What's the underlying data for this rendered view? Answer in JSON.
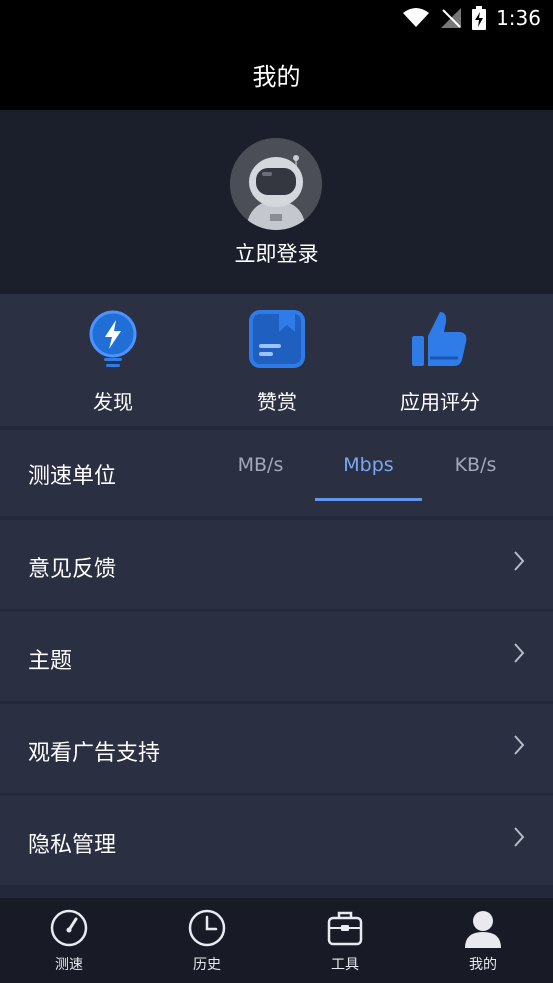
{
  "status_bar": {
    "time": "1:36",
    "icons": [
      "wifi-icon",
      "no-signal-icon",
      "battery-charging-icon"
    ]
  },
  "header": {
    "title": "我的"
  },
  "profile": {
    "login_label": "立即登录",
    "avatar_icon": "astronaut-avatar-icon"
  },
  "quick_actions": [
    {
      "label": "发现",
      "icon": "lightbulb-bolt-icon"
    },
    {
      "label": "赞赏",
      "icon": "book-bookmark-icon"
    },
    {
      "label": "应用评分",
      "icon": "thumbs-up-icon"
    }
  ],
  "speed_unit": {
    "label": "测速单位",
    "options": [
      "MB/s",
      "Mbps",
      "KB/s"
    ],
    "selected": "Mbps"
  },
  "menu": [
    {
      "label": "意见反馈"
    },
    {
      "label": "主题"
    },
    {
      "label": "观看广告支持"
    },
    {
      "label": "隐私管理"
    }
  ],
  "bottom_nav": [
    {
      "label": "测速",
      "icon": "speedometer-icon"
    },
    {
      "label": "历史",
      "icon": "clock-icon"
    },
    {
      "label": "工具",
      "icon": "toolbox-icon"
    },
    {
      "label": "我的",
      "icon": "user-icon",
      "active": true
    }
  ],
  "colors": {
    "accent": "#2f7be8",
    "active_tab": "#7aa7f0",
    "background": "#23283a"
  }
}
